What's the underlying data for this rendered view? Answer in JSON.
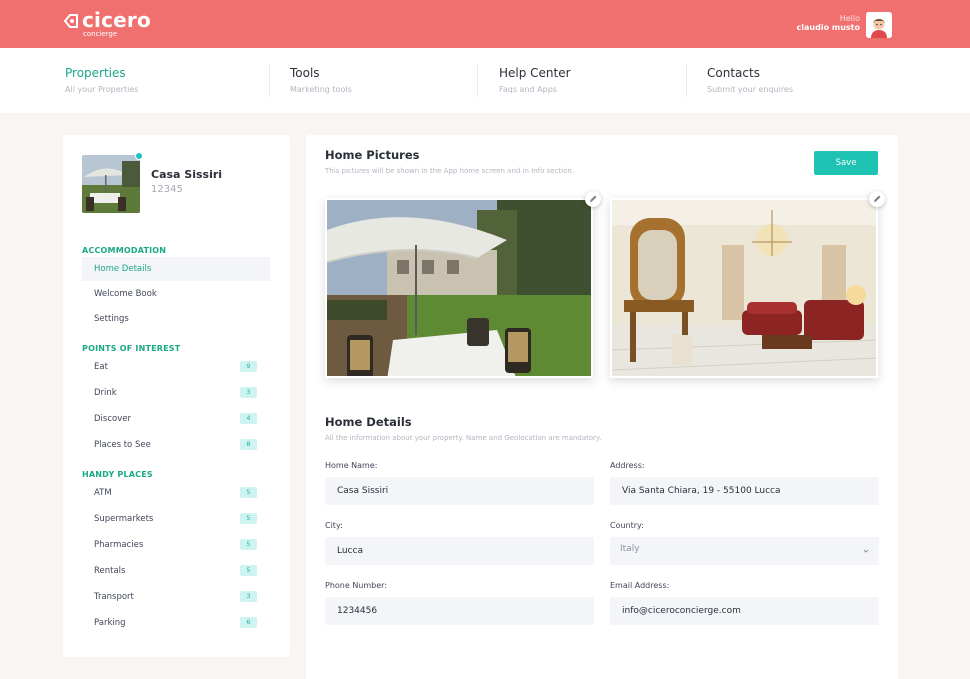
{
  "app": {
    "logo_name": "cicero",
    "logo_sub": "concierge",
    "greeting": "Hello",
    "user_name": "claudio musto"
  },
  "nav": {
    "items": [
      {
        "title": "Properties",
        "sub": "All your Properties"
      },
      {
        "title": "Tools",
        "sub": "Marketing tools"
      },
      {
        "title": "Help Center",
        "sub": "Faqs and Apps"
      },
      {
        "title": "Contacts",
        "sub": "Submit your enquires"
      }
    ]
  },
  "property": {
    "name": "Casa Sissiri",
    "id": "12345"
  },
  "sidebar": {
    "accommodation_title": "ACCOMMODATION",
    "accommodation": [
      {
        "label": "Home Details"
      },
      {
        "label": "Welcome Book"
      },
      {
        "label": "Settings"
      }
    ],
    "poi_title": "POINTS OF INTEREST",
    "poi": [
      {
        "label": "Eat",
        "count": "9"
      },
      {
        "label": "Drink",
        "count": "3"
      },
      {
        "label": "Discover",
        "count": "4"
      },
      {
        "label": "Places to See",
        "count": "8"
      }
    ],
    "handy_title": "HANDY PLACES",
    "handy": [
      {
        "label": "ATM",
        "count": "5"
      },
      {
        "label": "Supermarkets",
        "count": "5"
      },
      {
        "label": "Pharmacies",
        "count": "5"
      },
      {
        "label": "Rentals",
        "count": "5"
      },
      {
        "label": "Transport",
        "count": "3"
      },
      {
        "label": "Parking",
        "count": "6"
      }
    ]
  },
  "pictures": {
    "title": "Home Pictures",
    "subtitle": "This pictures will be shown in the App home screen and in Info section.",
    "save_label": "Save"
  },
  "details": {
    "title": "Home Details",
    "subtitle": "All the information about your property. Name and Geolocation are mandatory.",
    "home_name_label": "Home Name:",
    "home_name": "Casa Sissiri",
    "address_label": "Address:",
    "address": "Via Santa Chiara, 19 - 55100 Lucca",
    "city_label": "City:",
    "city": "Lucca",
    "country_label": "Country:",
    "country": "Italy",
    "phone_label": "Phone Number:",
    "phone": "1234456",
    "email_label": "Email Address:",
    "email": "info@ciceroconcierge.com"
  },
  "colors": {
    "brand": "#f07070",
    "accent_green": "#1aa886",
    "button_teal": "#1ec3b3",
    "badge_bg": "#cff3f0"
  }
}
